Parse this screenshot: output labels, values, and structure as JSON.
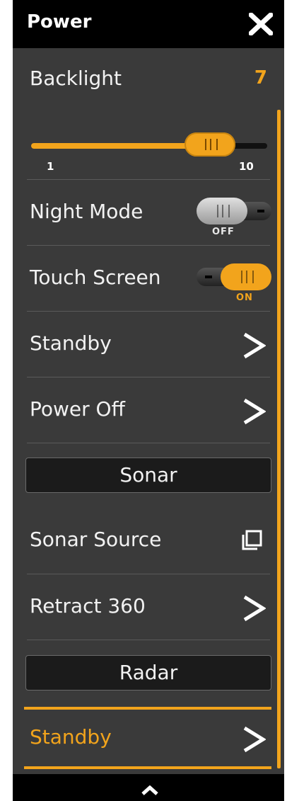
{
  "header": {
    "title": "Power"
  },
  "backlight": {
    "label": "Backlight",
    "value": "7",
    "level": 7,
    "min_label": "1",
    "max_label": "10",
    "min": 1,
    "max": 10
  },
  "night_mode": {
    "label": "Night Mode",
    "state": "OFF"
  },
  "touch_screen": {
    "label": "Touch Screen",
    "state": "ON"
  },
  "items": {
    "standby": "Standby",
    "power_off": "Power Off",
    "sonar_source": "Sonar Source",
    "retract_360": "Retract 360",
    "radar_standby": "Standby"
  },
  "sections": {
    "sonar": "Sonar",
    "radar": "Radar"
  },
  "colors": {
    "accent": "#f2a41c",
    "panel": "#3a3a3a",
    "header": "#000000"
  },
  "icons": {
    "close": "close-x-icon",
    "arrow": "chevron-right-icon",
    "source": "source-windows-icon",
    "scroll_up": "chevron-up-icon"
  }
}
